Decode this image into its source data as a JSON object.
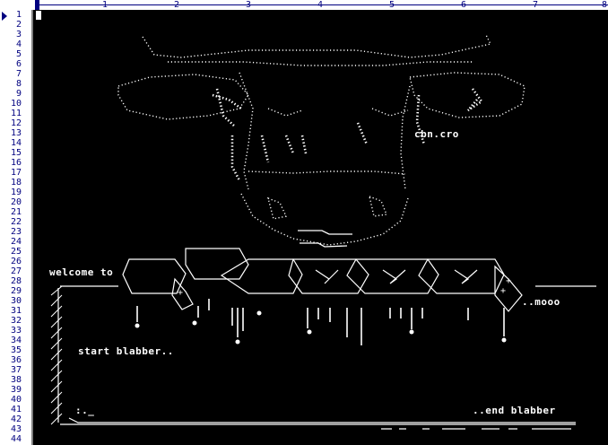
{
  "ruler": {
    "markers": [
      "1",
      "2",
      "3",
      "4",
      "5",
      "6",
      "7",
      "8"
    ]
  },
  "gutter": {
    "line_numbers": [
      "1",
      "2",
      "3",
      "4",
      "5",
      "6",
      "7",
      "8",
      "9",
      "10",
      "11",
      "12",
      "13",
      "14",
      "15",
      "16",
      "17",
      "18",
      "19",
      "20",
      "21",
      "22",
      "23",
      "24",
      "25",
      "26",
      "27",
      "28",
      "29",
      "30",
      "31",
      "32",
      "33",
      "34",
      "35",
      "36",
      "37",
      "38",
      "39",
      "40",
      "41",
      "42",
      "43",
      "44"
    ]
  },
  "art": {
    "tag": "cbn.cro",
    "welcome": "welcome to",
    "moo": "..mooo",
    "start": "start blabber..",
    "end": "..end blabber",
    "corner_mark": ":._"
  },
  "colors": {
    "background": "#000000",
    "foreground": "#ffffff",
    "gutter_text": "#000080"
  }
}
